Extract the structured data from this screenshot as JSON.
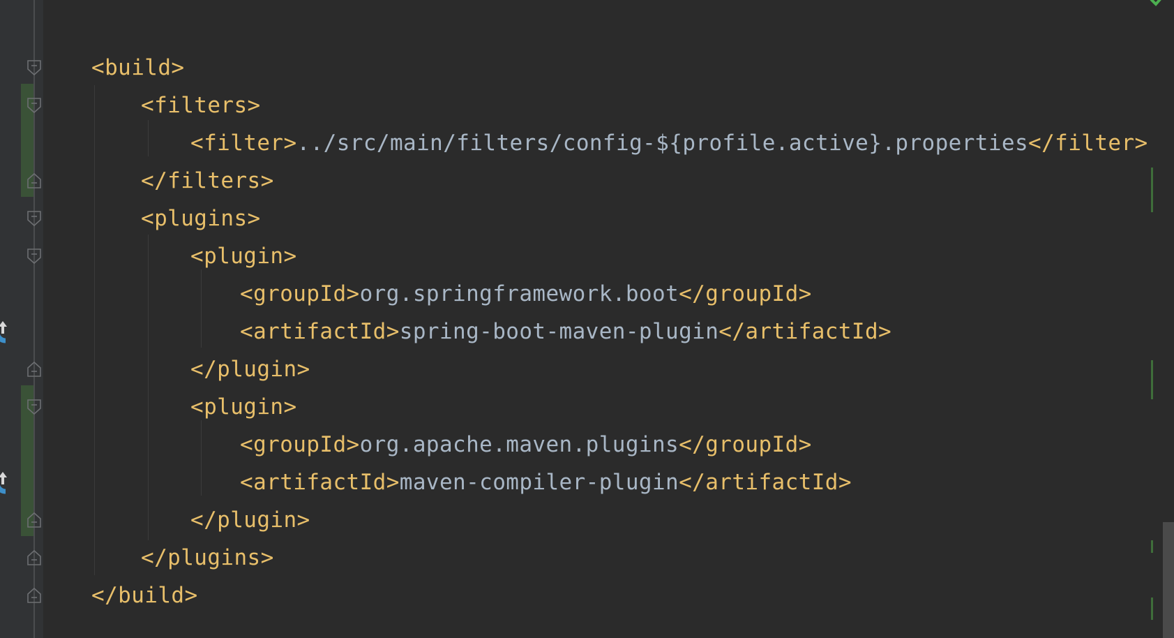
{
  "editor": {
    "lines": [
      {
        "parts": [
          {
            "t": "<build>",
            "c": "tag"
          }
        ]
      },
      {
        "parts": [
          {
            "t": "<filters>",
            "c": "tag"
          }
        ]
      },
      {
        "parts": [
          {
            "t": "<filter>",
            "c": "tag"
          },
          {
            "t": "../src/main/filters/config-${profile.active}.properties",
            "c": "txt"
          },
          {
            "t": "</filter>",
            "c": "tag"
          }
        ]
      },
      {
        "parts": [
          {
            "t": "</filters>",
            "c": "tag"
          }
        ]
      },
      {
        "parts": [
          {
            "t": "<plugins>",
            "c": "tag"
          }
        ]
      },
      {
        "parts": [
          {
            "t": "<plugin>",
            "c": "tag"
          }
        ]
      },
      {
        "parts": [
          {
            "t": "<groupId>",
            "c": "tag"
          },
          {
            "t": "org.springframework.boot",
            "c": "txt"
          },
          {
            "t": "</groupId>",
            "c": "tag"
          }
        ]
      },
      {
        "parts": [
          {
            "t": "<artifactId>",
            "c": "tag"
          },
          {
            "t": "spring-boot-maven-plugin",
            "c": "txt"
          },
          {
            "t": "</artifactId>",
            "c": "tag"
          }
        ]
      },
      {
        "parts": [
          {
            "t": "</plugin>",
            "c": "tag"
          }
        ]
      },
      {
        "parts": [
          {
            "t": "<plugin>",
            "c": "tag"
          }
        ]
      },
      {
        "parts": [
          {
            "t": "<groupId>",
            "c": "tag"
          },
          {
            "t": "org.apache.maven.plugins",
            "c": "txt"
          },
          {
            "t": "</groupId>",
            "c": "tag"
          }
        ]
      },
      {
        "parts": [
          {
            "t": "<artifactId>",
            "c": "tag"
          },
          {
            "t": "maven-compiler-plugin",
            "c": "txt"
          },
          {
            "t": "</artifactId>",
            "c": "tag"
          }
        ]
      },
      {
        "parts": [
          {
            "t": "</plugin>",
            "c": "tag"
          }
        ]
      },
      {
        "parts": [
          {
            "t": "</plugins>",
            "c": "tag"
          }
        ]
      },
      {
        "parts": [
          {
            "t": "</build>",
            "c": "tag"
          }
        ]
      }
    ]
  },
  "colors": {
    "background": "#2b2b2b",
    "tag": "#e8bf6a",
    "text": "#a9b7c6",
    "gutter": "#313335",
    "vcs_changed": "#3a5237",
    "override_icon": "#3d8fc9",
    "inspection_ok": "#4caf50"
  },
  "icons": {
    "fold_start": "fold-collapse-icon",
    "fold_end": "fold-end-icon",
    "override": "override-method-icon",
    "status": "check-mark-icon"
  }
}
